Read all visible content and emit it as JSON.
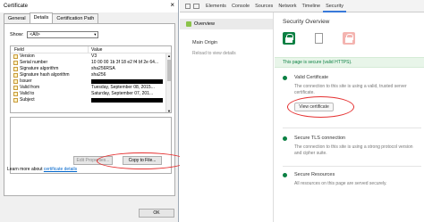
{
  "certificate": {
    "title": "Certificate",
    "close": "×",
    "tabs": [
      "General",
      "Details",
      "Certification Path"
    ],
    "show_label": "Show:",
    "show_value": "<All>",
    "columns": [
      "Field",
      "Value"
    ],
    "fields": [
      {
        "name": "Version",
        "value": "V3"
      },
      {
        "name": "Serial number",
        "value": "10 00 00 1b 3f 18 e2 f4 bf 2e 64..."
      },
      {
        "name": "Signature algorithm",
        "value": "sha256RSA"
      },
      {
        "name": "Signature hash algorithm",
        "value": "sha256"
      },
      {
        "name": "Issuer",
        "value": ""
      },
      {
        "name": "Valid from",
        "value": "Tuesday, September 08, 2015..."
      },
      {
        "name": "Valid to",
        "value": "Saturday, September 07, 201..."
      },
      {
        "name": "Subject",
        "value": ""
      }
    ],
    "edit_properties": "Edit Properties...",
    "copy_to_file": "Copy to File...",
    "learn_prefix": "Learn more about ",
    "learn_link": "certificate details",
    "ok": "OK"
  },
  "devtools": {
    "tabs": [
      "Elements",
      "Console",
      "Sources",
      "Network",
      "Timeline",
      "Security"
    ],
    "active_tab": "Security",
    "sidebar": {
      "overview": "Overview",
      "main_origin": "Main Origin",
      "reload": "Reload to view details"
    },
    "overview_title": "Security Overview",
    "secure_banner": "This page is secure (valid HTTPS).",
    "valid_cert_title": "Valid Certificate",
    "valid_cert_desc": "The connection to this site is using a valid, trusted server certificate.",
    "view_certificate": "View certificate",
    "tls_title": "Secure TLS connection",
    "tls_desc": "The connection to this site is using a strong protocol version and cipher suite.",
    "resources_title": "Secure Resources",
    "resources_desc": "All resources on this page are served securely.",
    "colors": {
      "secure": "#0b8043",
      "accent": "#3879d9",
      "annotation": "#e53030"
    }
  }
}
